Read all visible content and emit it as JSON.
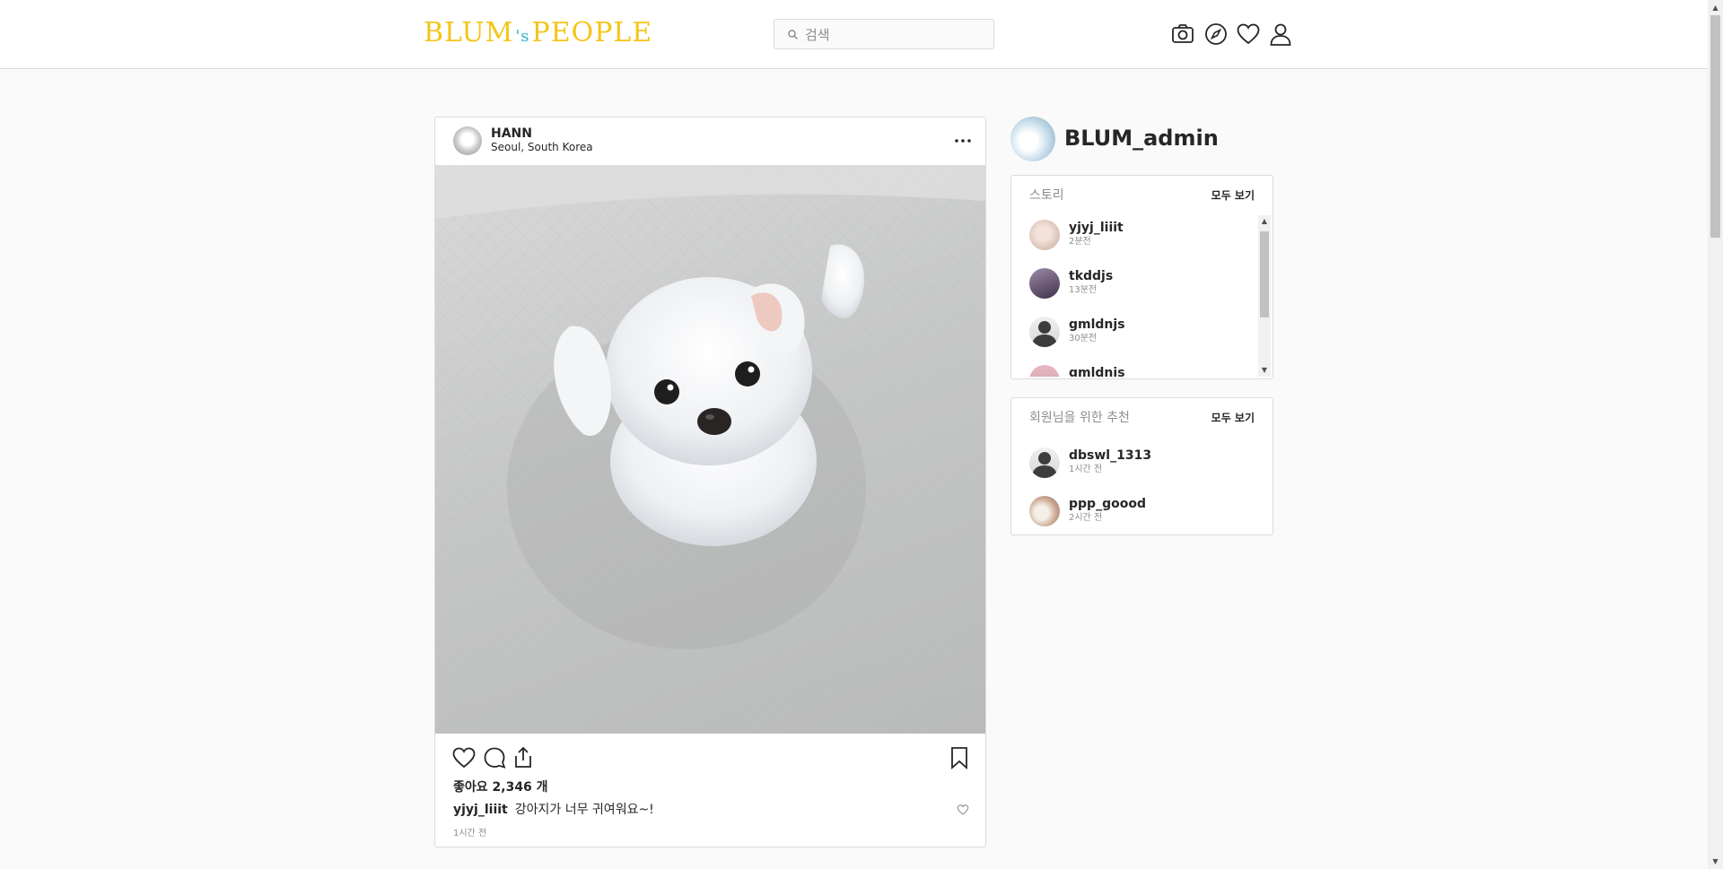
{
  "header": {
    "logo_main": "BLUM",
    "logo_mid": "'s",
    "logo_tail": "PEOPLE",
    "search_placeholder": "검색",
    "accent_color": "#f5c518",
    "icons": [
      "camera-icon",
      "compass-icon",
      "heart-icon",
      "user-icon"
    ]
  },
  "post": {
    "author": "HANN",
    "location": "Seoul, South Korea",
    "likes_text": "좋아요 2,346 개",
    "comment": {
      "user": "yjyj_liiit",
      "text": "강아지가 너무 귀여워요~!"
    },
    "time": "1시간 전"
  },
  "sidebar": {
    "username": "BLUM_admin",
    "stories": {
      "title": "스토리",
      "see_all": "모두 보기",
      "items": [
        {
          "name": "yjyj_liiit",
          "time": "2분전"
        },
        {
          "name": "tkddjs",
          "time": "13분전"
        },
        {
          "name": "gmldnjs",
          "time": "30분전"
        },
        {
          "name": "gmldnjs",
          "time": ""
        }
      ]
    },
    "recommend": {
      "title": "회원님을 위한 추천",
      "see_all": "모두 보기",
      "items": [
        {
          "name": "dbswl_1313",
          "time": "1시간 전"
        },
        {
          "name": "ppp_goood",
          "time": "2시간 전"
        }
      ]
    }
  }
}
